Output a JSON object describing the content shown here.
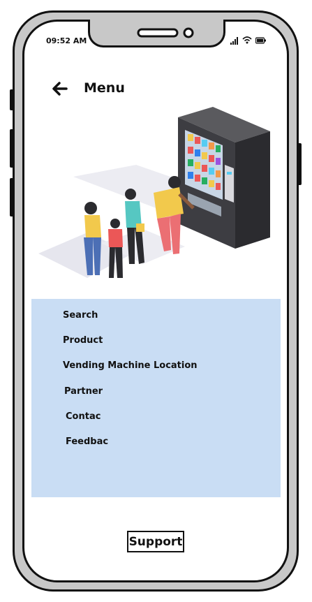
{
  "status_bar": {
    "time": "09:52 AM"
  },
  "header": {
    "title": "Menu"
  },
  "menu": {
    "items": [
      {
        "label": "Search"
      },
      {
        "label": "Product"
      },
      {
        "label": "Vending Machine Location"
      },
      {
        "label": "Partner"
      },
      {
        "label": "Contac"
      },
      {
        "label": "Feedbac"
      }
    ]
  },
  "footer": {
    "support_label": "Support"
  },
  "colors": {
    "menu_panel": "#c9ddf4",
    "frame": "#c8c8c8",
    "ink": "#111111"
  },
  "icons": [
    "back-arrow-icon",
    "signal-icon",
    "wifi-icon",
    "battery-icon",
    "vending-machine-illustration"
  ]
}
